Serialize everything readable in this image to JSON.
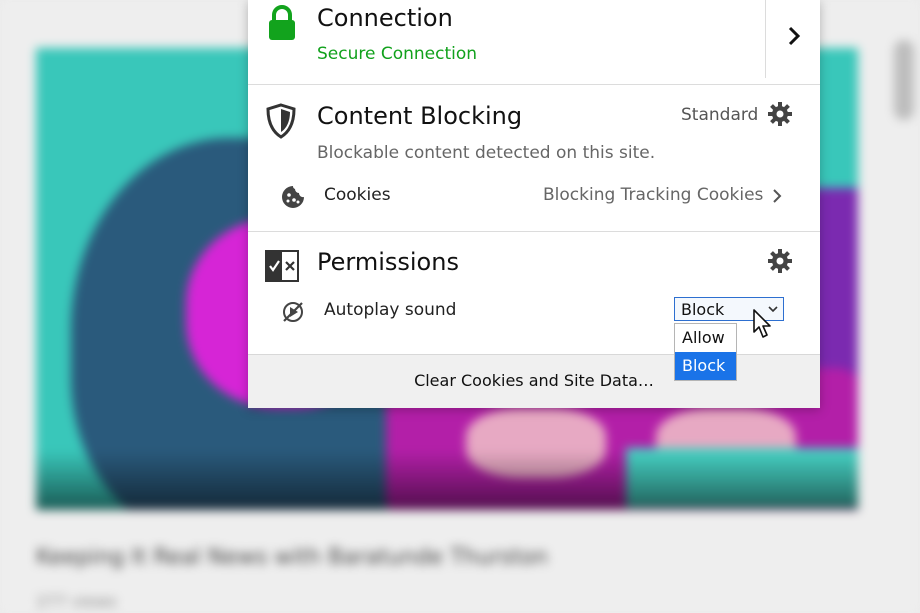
{
  "background": {
    "video_title": "Keeping It Real News with Baratunde Thurston",
    "video_meta": "277 views"
  },
  "identity_panel": {
    "connection": {
      "title": "Connection",
      "status": "Secure Connection",
      "status_color": "#11a11c"
    },
    "content_blocking": {
      "title": "Content Blocking",
      "mode": "Standard",
      "description": "Blockable content detected on this site.",
      "cookies_label": "Cookies",
      "cookies_status": "Blocking Tracking Cookies"
    },
    "permissions": {
      "title": "Permissions",
      "autoplay_label": "Autoplay sound",
      "autoplay_selected": "Block",
      "autoplay_options": [
        "Allow",
        "Block"
      ],
      "highlight_color": "#1a73e8"
    },
    "footer": {
      "clear_label": "Clear Cookies and Site Data…"
    }
  },
  "icons": [
    "lock-icon",
    "chevron-right-icon",
    "shield-icon",
    "gear-icon",
    "cookie-icon",
    "permissions-icon",
    "autoplay-blocked-icon",
    "chevron-down-icon",
    "mouse-cursor-icon"
  ]
}
